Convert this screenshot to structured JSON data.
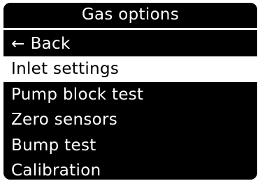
{
  "header": {
    "title": "Gas options"
  },
  "menu": {
    "back": {
      "icon": "left-arrow-icon",
      "arrow_glyph": "←",
      "label": "Back"
    },
    "items": [
      {
        "label": "Inlet settings",
        "selected": true
      },
      {
        "label": "Pump block test",
        "selected": false
      },
      {
        "label": "Zero sensors",
        "selected": false
      },
      {
        "label": "Bump test",
        "selected": false
      },
      {
        "label": "Calibration",
        "selected": false
      }
    ]
  },
  "colors": {
    "background": "#000000",
    "foreground": "#ffffff",
    "highlight_background": "#ffffff",
    "highlight_foreground": "#000000"
  }
}
